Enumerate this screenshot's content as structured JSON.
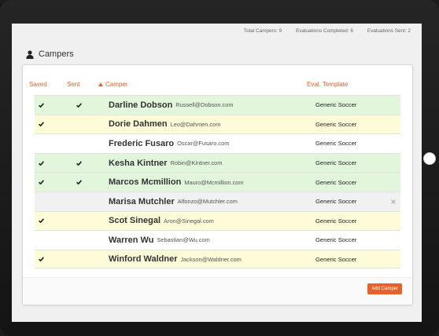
{
  "stats": {
    "total_campers": "Total Campers: 9",
    "evaluations_completed": "Evaluations Completed: 6",
    "evaluations_sent": "Evaluations Sent: 2"
  },
  "section": {
    "title": "Campers",
    "icon": "user-icon"
  },
  "table": {
    "headers": {
      "saved": "Saved",
      "sent": "Sent",
      "camper": "Camper",
      "eval_template": "Eval. Template"
    },
    "sort_icon": "sort-ascending-icon",
    "rows": [
      {
        "name": "Darline Dobson",
        "email": "Russell@Dobson.com",
        "template": "Generic Soccer",
        "saved": true,
        "sent": true,
        "tone": "green"
      },
      {
        "name": "Dorie Dahmen",
        "email": "Leo@Dahmen.com",
        "template": "Generic Soccer",
        "saved": true,
        "sent": false,
        "tone": "yellow"
      },
      {
        "name": "Frederic Fusaro",
        "email": "Oscar@Fusaro.com",
        "template": "Generic Soccer",
        "saved": false,
        "sent": false,
        "tone": "white"
      },
      {
        "name": "Kesha Kintner",
        "email": "Robin@Kintner.com",
        "template": "Generic Soccer",
        "saved": true,
        "sent": true,
        "tone": "green"
      },
      {
        "name": "Marcos Mcmillion",
        "email": "Mauro@Mcmillion.com",
        "template": "Generic Soccer",
        "saved": true,
        "sent": true,
        "tone": "green"
      },
      {
        "name": "Marisa Mutchler",
        "email": "Alfonzo@Mutchler.com",
        "template": "Generic Soccer",
        "saved": false,
        "sent": false,
        "tone": "grey",
        "removable": true
      },
      {
        "name": "Scot Sinegal",
        "email": "Aron@Sinegal.com",
        "template": "Generic Soccer",
        "saved": true,
        "sent": false,
        "tone": "yellow"
      },
      {
        "name": "Warren Wu",
        "email": "Sebastian@Wu.com",
        "template": "Generic Soccer",
        "saved": false,
        "sent": false,
        "tone": "white"
      },
      {
        "name": "Winford Waldner",
        "email": "Jackson@Waldner.com",
        "template": "Generic Soccer",
        "saved": true,
        "sent": false,
        "tone": "yellow"
      }
    ]
  },
  "add_button_label": "Add Camper",
  "colors": {
    "accent": "#e8612c",
    "row_green": "#e2f6dc",
    "row_yellow": "#fdfbd8",
    "row_grey": "#f1f1f1"
  }
}
